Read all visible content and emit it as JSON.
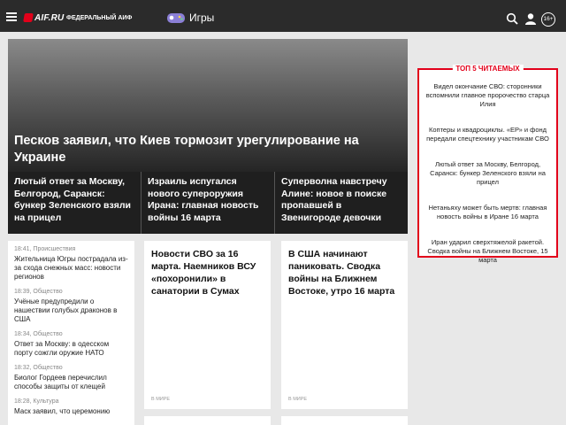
{
  "header": {
    "logo_text": "AIF.RU",
    "brand_sub": "ФЕДЕРАЛЬНЫЙ АИФ",
    "section_label": "Игры",
    "age_badge": "16+",
    "brand_color": "#e2001a"
  },
  "hero": {
    "title": "Песков заявил, что Киев тормозит урегулирование на Украине"
  },
  "sub_items": [
    {
      "title": "Лютый ответ за Москву, Белгород, Саранск: бункер Зеленского взяли на прицел"
    },
    {
      "title": "Израиль испугался нового супероружия Ирана: главная новость войны 16 марта"
    },
    {
      "title": "Суперволна навстречу Алине: новое в поиске пропавшей в Звенигороде девочки"
    }
  ],
  "feed": [
    {
      "meta": "18:41, Происшествия",
      "title": "Жительница Югры пострадала из-за схода снежных масс: новости регионов"
    },
    {
      "meta": "18:39, Общество",
      "title": "Учёные предупредили о нашествии голубых драконов в США"
    },
    {
      "meta": "18:34, Общество",
      "title": "Ответ за Москву: в одесском порту сожгли оружие НАТО"
    },
    {
      "meta": "18:32, Общество",
      "title": "Биолог Гордеев перечислил способы защиты от клещей"
    },
    {
      "meta": "18:28, Культура",
      "title": "Маск заявил, что церемонию"
    }
  ],
  "cards": [
    {
      "title": "Новости СВО за 16 марта. Наемников ВСУ «похоронили» в санатории в Сумах",
      "tag": "В МИРЕ"
    },
    {
      "title": "В США начинают паниковать. Сводка войны на Ближнем Востоке, утро 16 марта",
      "tag": "В МИРЕ"
    }
  ],
  "top5": {
    "title": "ТОП 5 ЧИТАЕМЫХ",
    "items": [
      "Видел окончание СВО: сторонники вспомнили главное пророчество старца Илия",
      "Коптеры и квадроциклы. «ЕР» и фонд передали спецтехнику участникам СВО",
      "Лютый ответ за Москву, Белгород, Саранск: бункер Зеленского взяли на прицел",
      "Нетаньяху может быть мертв: главная новость войны в Иране 16 марта",
      "Иран ударил сверхтяжелой ракетой. Сводка войны на Ближнем Востоке, 15 марта"
    ]
  }
}
